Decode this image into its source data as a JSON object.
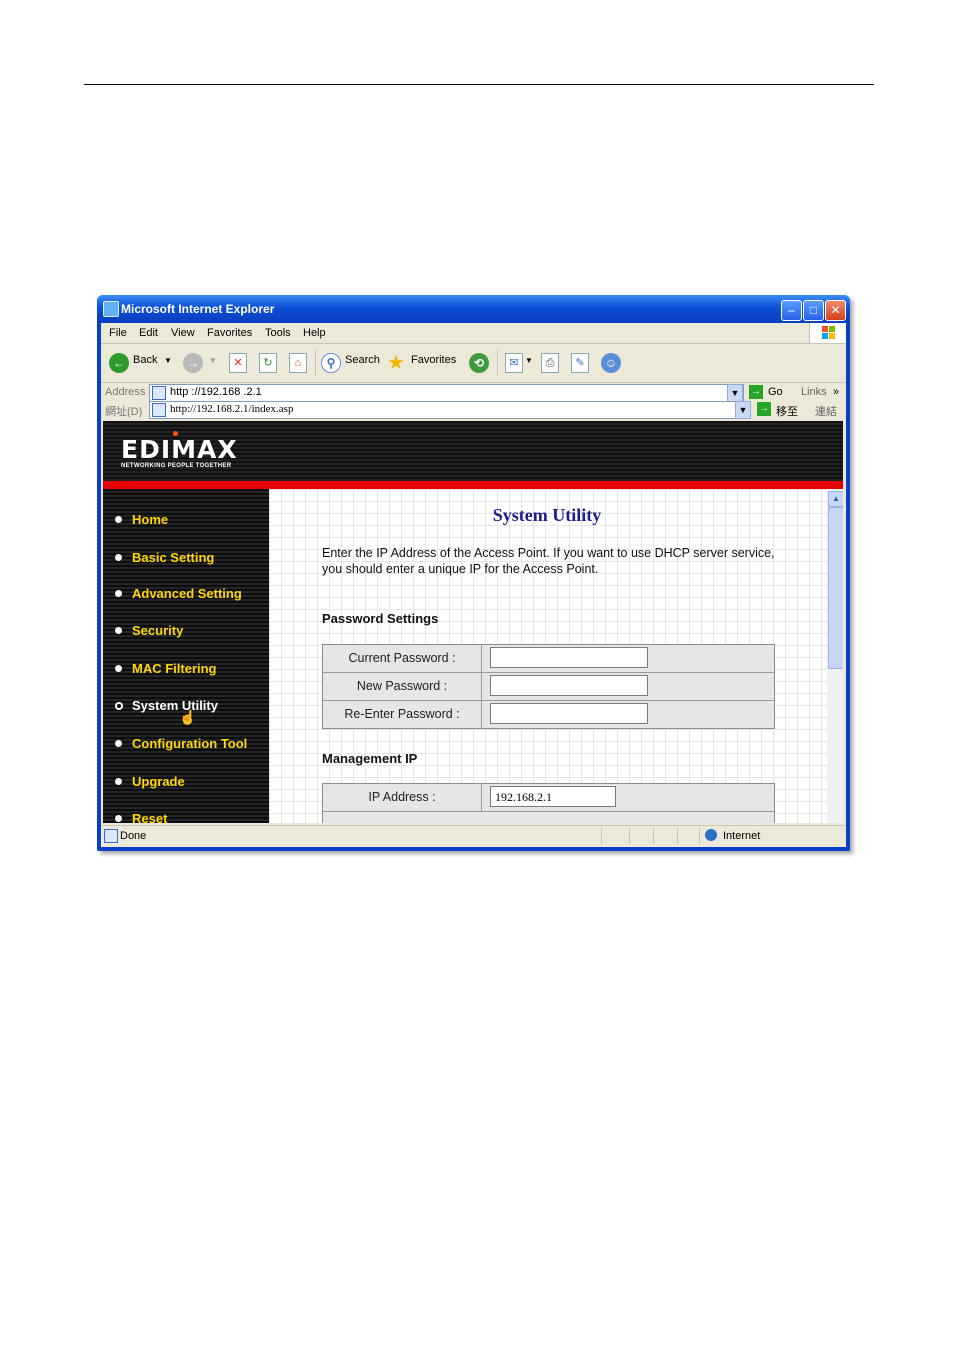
{
  "window": {
    "title": "Microsoft Internet Explorer"
  },
  "menu": [
    "File",
    "Edit",
    "View",
    "Favorites",
    "Tools",
    "Help"
  ],
  "toolbar": {
    "back_label": "Back",
    "search_label": "Search",
    "favorites_label": "Favorites"
  },
  "address_bar": {
    "label": "Address",
    "url": "http ://192.168 .2.1",
    "go_label": "Go",
    "links_label": "Links",
    "row2_label": "網址(D)",
    "row2_url": "http://192.168.2.1/index.asp",
    "row2_go_label": "移至",
    "row2_links_label": "連結"
  },
  "brand": {
    "logo": "EDIMAX",
    "tagline": "NETWORKING PEOPLE TOGETHER"
  },
  "nav": {
    "items": [
      {
        "label": "Home"
      },
      {
        "label": "Basic Setting"
      },
      {
        "label": "Advanced Setting"
      },
      {
        "label": "Security"
      },
      {
        "label": "MAC Filtering"
      },
      {
        "label": "System Utility"
      },
      {
        "label": "Configuration Tool"
      },
      {
        "label": "Upgrade"
      },
      {
        "label": "Reset"
      }
    ]
  },
  "main": {
    "title": "System Utility",
    "intro": "Enter the IP Address of the Access Point. If you want to use DHCP server service, you should enter a unique IP for the Access Point.",
    "password_section": {
      "heading": "Password Settings",
      "rows": [
        {
          "label": "Current Password :",
          "value": ""
        },
        {
          "label": "New Password :",
          "value": ""
        },
        {
          "label": "Re-Enter Password :",
          "value": ""
        }
      ]
    },
    "management_section": {
      "heading": "Management IP",
      "rows": [
        {
          "label": "IP Address :",
          "value": "192.168.2.1"
        }
      ]
    }
  },
  "status": {
    "text": "Done",
    "zone": "Internet"
  }
}
